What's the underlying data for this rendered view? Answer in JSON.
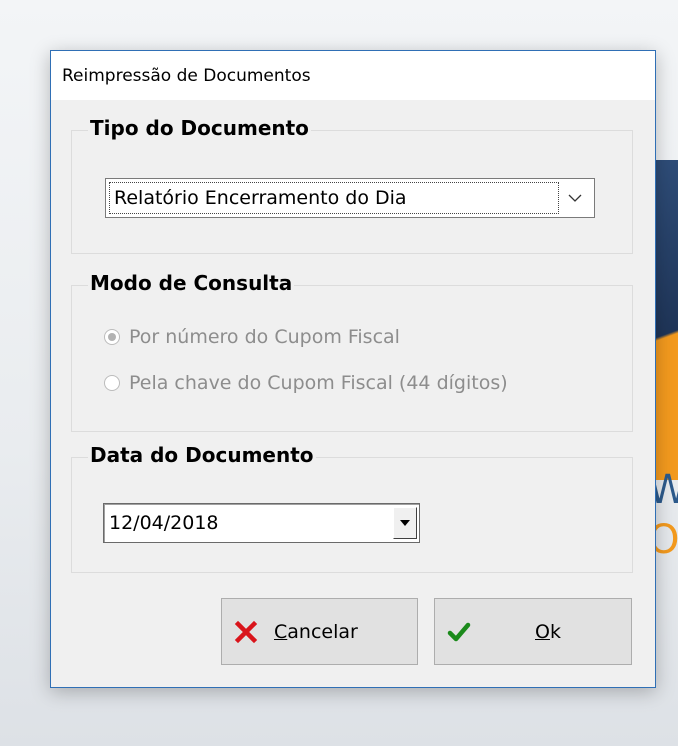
{
  "dialog": {
    "title": "Reimpressão de Documentos",
    "tipo_documento": {
      "label": "Tipo do Documento",
      "selected": "Relatório Encerramento do Dia"
    },
    "modo_consulta": {
      "label": "Modo de Consulta",
      "options": [
        {
          "label": "Por número do Cupom Fiscal",
          "checked": true,
          "enabled": false
        },
        {
          "label": "Pela chave do Cupom Fiscal (44 dígitos)",
          "checked": false,
          "enabled": false
        }
      ]
    },
    "data_documento": {
      "label": "Data do Documento",
      "value": "12/04/2018"
    },
    "buttons": {
      "cancel": {
        "accel": "C",
        "rest": "ancelar",
        "icon": "x-icon",
        "icon_color": "#d9141b"
      },
      "ok": {
        "accel": "O",
        "rest": "k",
        "icon": "check-icon",
        "icon_color": "#1b8a1b"
      }
    }
  },
  "background": {
    "text_line_1": "W",
    "text_line_2": "O"
  }
}
